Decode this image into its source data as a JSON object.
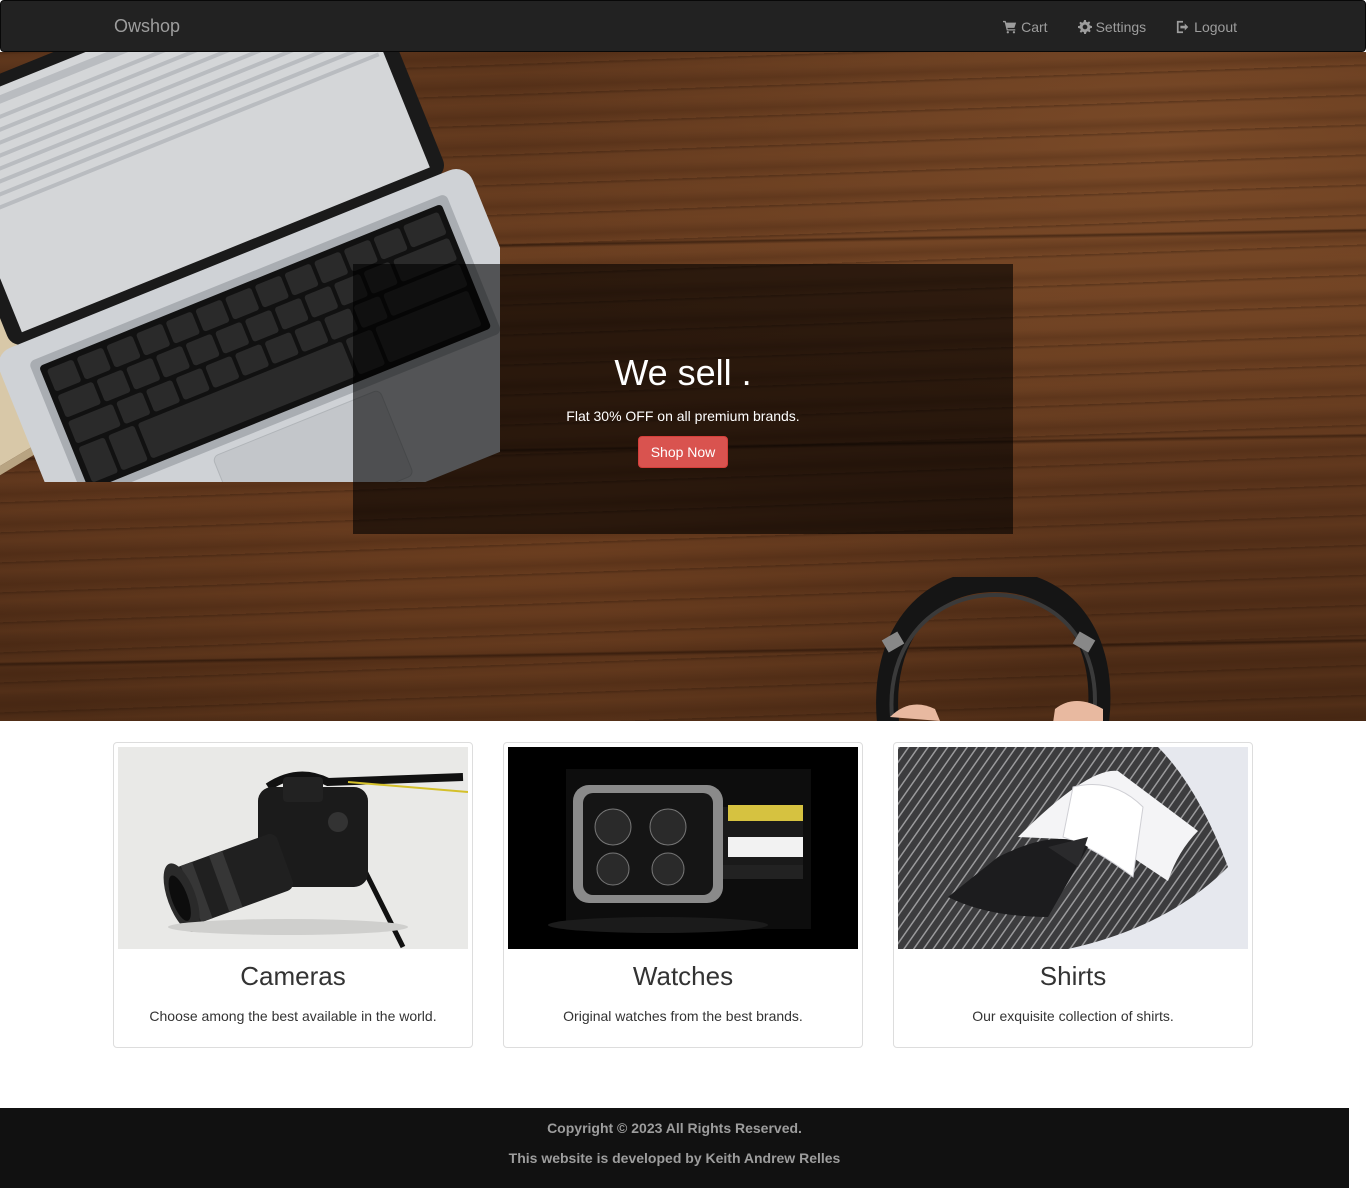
{
  "navbar": {
    "brand": "Owshop",
    "links": [
      {
        "label": "Cart",
        "icon": "cart-icon"
      },
      {
        "label": "Settings",
        "icon": "gear-icon"
      },
      {
        "label": "Logout",
        "icon": "logout-icon"
      }
    ]
  },
  "hero": {
    "title": "We sell .",
    "subtitle": "Flat 30% OFF on all premium brands.",
    "button_label": "Shop Now"
  },
  "cards": [
    {
      "title": "Cameras",
      "text": "Choose among the best available in the world."
    },
    {
      "title": "Watches",
      "text": "Original watches from the best brands."
    },
    {
      "title": "Shirts",
      "text": "Our exquisite collection of shirts."
    }
  ],
  "footer": {
    "copyright": "Copyright © 2023 All Rights Reserved.",
    "credit": "This website is developed by Keith Andrew Relles"
  },
  "colors": {
    "navbar_bg": "#222222",
    "accent_button": "#d9534f",
    "footer_bg": "#111111"
  }
}
